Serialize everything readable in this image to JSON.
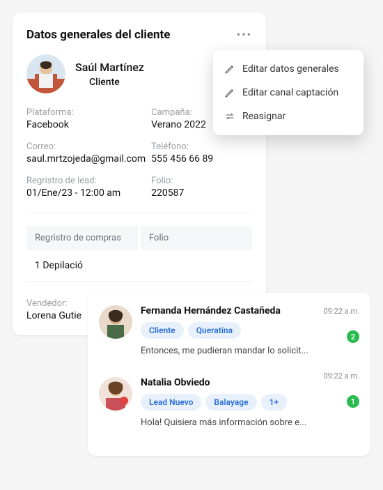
{
  "card": {
    "title": "Datos generales  del cliente",
    "client_name": "Saúl Martínez",
    "status_label": "Cliente",
    "status_color": "#2abb4e",
    "fields": {
      "platform_label": "Plataforma:",
      "platform_value": "Facebook",
      "campaign_label": "Campaña:",
      "campaign_value": "Verano 2022",
      "email_label": "Correo:",
      "email_value": "saul.mrtzojeda@gmail.com",
      "phone_label": "Teléfono:",
      "phone_value": "555 456 66 89",
      "lead_label": "Regristro de lead:",
      "lead_value": "01/Ene/23 - 12:00 am",
      "folio_label": "Folio:",
      "folio_value": "220587"
    },
    "table": {
      "col1": "Regristro de compras",
      "col2": "Folio",
      "row1_col1": "1 Depilació"
    },
    "seller_label": "Vendedor:",
    "seller_value": "Lorena Gutie"
  },
  "menu": {
    "item1": "Editar datos generales",
    "item2": "Editar canal captación",
    "item3": "Reasignar"
  },
  "convo": [
    {
      "name": "Fernanda  Hernández Castañeda",
      "time": "09:22 a.m.",
      "tags": [
        "Cliente",
        "Queratina"
      ],
      "preview": "Entonces, me pudieran mandar lo solicit...",
      "badge": "2"
    },
    {
      "name": "Natalia Obviedo",
      "time": "09:22 a.m.",
      "tags": [
        "Lead Nuevo",
        "Balayage",
        "1+"
      ],
      "preview": "Hola! Quisiera más información sobre e...",
      "badge": "1"
    }
  ]
}
